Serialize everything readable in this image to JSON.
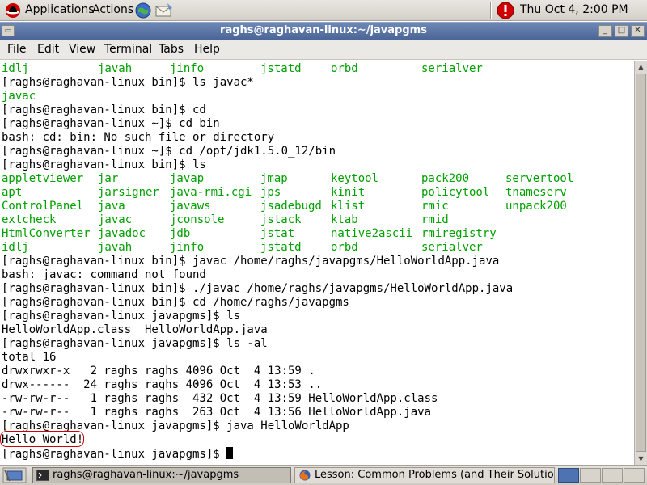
{
  "top_panel": {
    "applications_label": "Applications",
    "actions_label": "Actions",
    "clock": "Thu Oct  4,  2:00 PM"
  },
  "window": {
    "title": "raghs@raghavan-linux:~/javapgms"
  },
  "menubar": {
    "file": "File",
    "edit": "Edit",
    "view": "View",
    "terminal": "Terminal",
    "tabs": "Tabs",
    "help": "Help"
  },
  "terminal": {
    "ls_columns_partial_top": [
      "idlj",
      "javah",
      "jinfo",
      "jstatd",
      "orbd",
      "serialver"
    ],
    "lines_a": [
      "[raghs@raghavan-linux bin]$ ls javac*"
    ],
    "javac_match": "javac",
    "lines_b": [
      "[raghs@raghavan-linux bin]$ cd",
      "[raghs@raghavan-linux ~]$ cd bin",
      "bash: cd: bin: No such file or directory",
      "[raghs@raghavan-linux ~]$ cd /opt/jdk1.5.0_12/bin",
      "[raghs@raghavan-linux bin]$ ls"
    ],
    "ls_rows": [
      [
        "appletviewer",
        "jar",
        "javap",
        "jmap",
        "keytool",
        "pack200",
        "servertool"
      ],
      [
        "apt",
        "jarsigner",
        "java-rmi.cgi",
        "jps",
        "kinit",
        "policytool",
        "tnameserv"
      ],
      [
        "ControlPanel",
        "java",
        "javaws",
        "jsadebugd",
        "klist",
        "rmic",
        "unpack200"
      ],
      [
        "extcheck",
        "javac",
        "jconsole",
        "jstack",
        "ktab",
        "rmid",
        ""
      ],
      [
        "HtmlConverter",
        "javadoc",
        "jdb",
        "jstat",
        "native2ascii",
        "rmiregistry",
        ""
      ],
      [
        "idlj",
        "javah",
        "jinfo",
        "jstatd",
        "orbd",
        "serialver",
        ""
      ]
    ],
    "lines_c": [
      "[raghs@raghavan-linux bin]$ javac /home/raghs/javapgms/HelloWorldApp.java",
      "bash: javac: command not found",
      "[raghs@raghavan-linux bin]$ ./javac /home/raghs/javapgms/HelloWorldApp.java",
      "[raghs@raghavan-linux bin]$ cd /home/raghs/javapgms",
      "[raghs@raghavan-linux javapgms]$ ls",
      "HelloWorldApp.class  HelloWorldApp.java",
      "[raghs@raghavan-linux javapgms]$ ls -al",
      "total 16",
      "drwxrwxr-x   2 raghs raghs 4096 Oct  4 13:59 .",
      "drwx------  24 raghs raghs 4096 Oct  4 13:53 ..",
      "-rw-rw-r--   1 raghs raghs  432 Oct  4 13:59 HelloWorldApp.class",
      "-rw-rw-r--   1 raghs raghs  263 Oct  4 13:56 HelloWorldApp.java",
      "[raghs@raghavan-linux javapgms]$ java HelloWorldApp",
      "Hello World!"
    ],
    "prompt": "[raghs@raghavan-linux javapgms]$ "
  },
  "taskbar": {
    "terminal_task": "raghs@raghavan-linux:~/javapgms",
    "browser_task": "Lesson: Common Problems (and Their Solutions) (J"
  },
  "colors": {
    "listing_green": "#00a000",
    "title_bar": "#4a6596",
    "highlight_circle": "#cc0000"
  }
}
